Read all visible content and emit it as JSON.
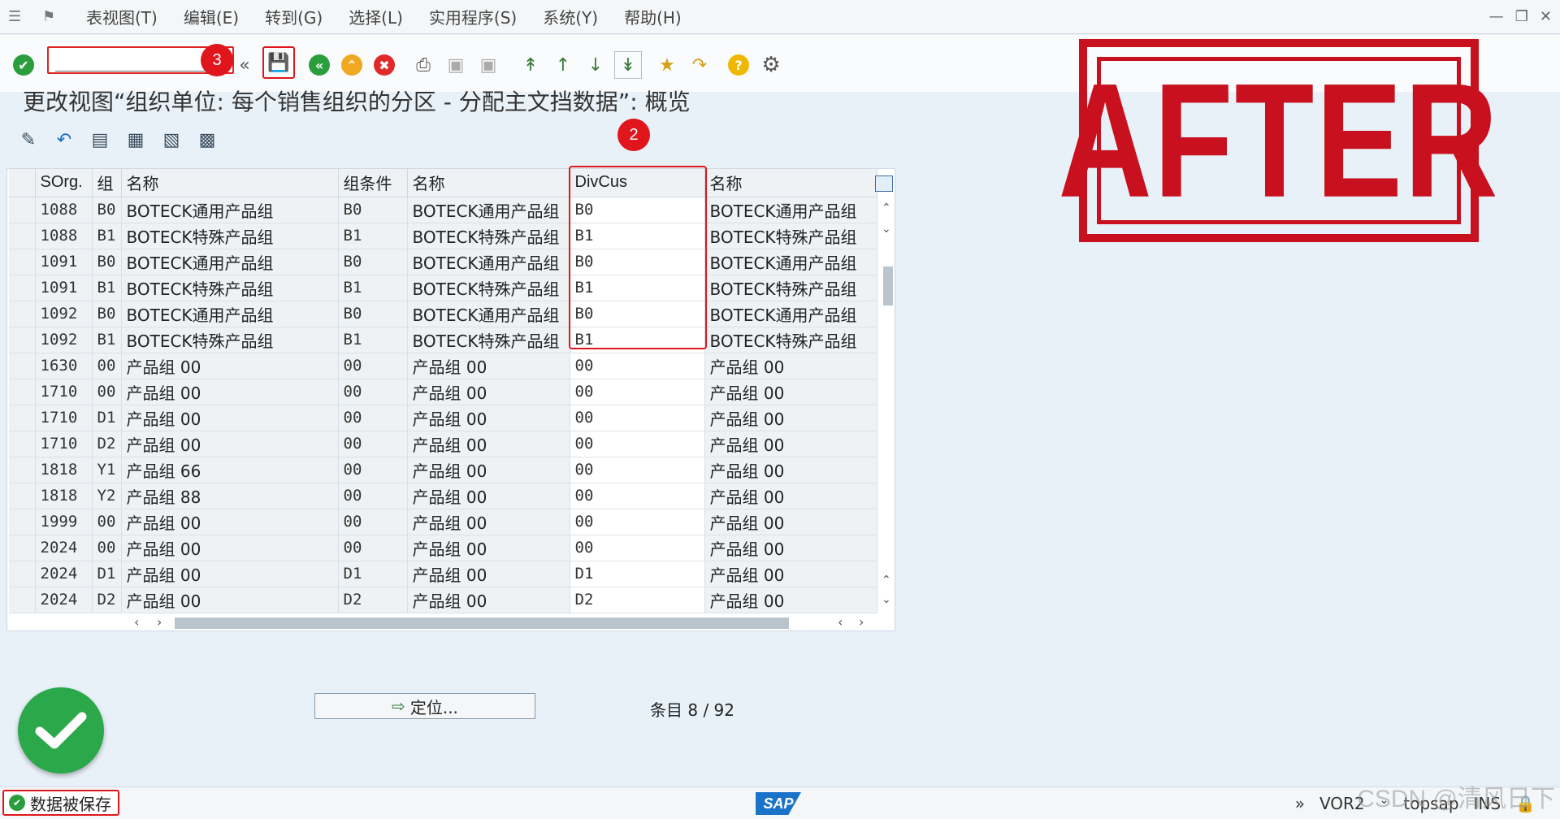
{
  "menubar": {
    "items": [
      "表视图(T)",
      "编辑(E)",
      "转到(G)",
      "选择(L)",
      "实用程序(S)",
      "系统(Y)",
      "帮助(H)"
    ]
  },
  "toolbar": {
    "command_value": "",
    "badge_3": "3",
    "badge_2": "2"
  },
  "title": "更改视图“组织单位: 每个销售组织的分区 - 分配主文挡数据”: 概览",
  "table": {
    "headers": [
      "SOrg.",
      "组",
      "名称",
      "组条件",
      "名称",
      "DivCus",
      "名称"
    ],
    "rows": [
      [
        "1088",
        "B0",
        "BOTECK通用产品组",
        "B0",
        "BOTECK通用产品组",
        "B0",
        "BOTECK通用产品组"
      ],
      [
        "1088",
        "B1",
        "BOTECK特殊产品组",
        "B1",
        "BOTECK特殊产品组",
        "B1",
        "BOTECK特殊产品组"
      ],
      [
        "1091",
        "B0",
        "BOTECK通用产品组",
        "B0",
        "BOTECK通用产品组",
        "B0",
        "BOTECK通用产品组"
      ],
      [
        "1091",
        "B1",
        "BOTECK特殊产品组",
        "B1",
        "BOTECK特殊产品组",
        "B1",
        "BOTECK特殊产品组"
      ],
      [
        "1092",
        "B0",
        "BOTECK通用产品组",
        "B0",
        "BOTECK通用产品组",
        "B0",
        "BOTECK通用产品组"
      ],
      [
        "1092",
        "B1",
        "BOTECK特殊产品组",
        "B1",
        "BOTECK特殊产品组",
        "B1",
        "BOTECK特殊产品组"
      ],
      [
        "1630",
        "00",
        "产品组 00",
        "00",
        "产品组 00",
        "00",
        "产品组 00"
      ],
      [
        "1710",
        "00",
        "产品组 00",
        "00",
        "产品组 00",
        "00",
        "产品组 00"
      ],
      [
        "1710",
        "D1",
        "产品组 00",
        "00",
        "产品组 00",
        "00",
        "产品组 00"
      ],
      [
        "1710",
        "D2",
        "产品组 00",
        "00",
        "产品组 00",
        "00",
        "产品组 00"
      ],
      [
        "1818",
        "Y1",
        "产品组 66",
        "00",
        "产品组 00",
        "00",
        "产品组 00"
      ],
      [
        "1818",
        "Y2",
        "产品组 88",
        "00",
        "产品组 00",
        "00",
        "产品组 00"
      ],
      [
        "1999",
        "00",
        "产品组 00",
        "00",
        "产品组 00",
        "00",
        "产品组 00"
      ],
      [
        "2024",
        "00",
        "产品组 00",
        "00",
        "产品组 00",
        "00",
        "产品组 00"
      ],
      [
        "2024",
        "D1",
        "产品组 00",
        "D1",
        "产品组 00",
        "D1",
        "产品组 00"
      ],
      [
        "2024",
        "D2",
        "产品组 00",
        "D2",
        "产品组 00",
        "D2",
        "产品组 00"
      ]
    ]
  },
  "footer": {
    "position_button": "定位...",
    "entry_info": "条目 8 / 92"
  },
  "stamp": "AFTER",
  "statusbar": {
    "message": "数据被保存",
    "logo": "SAP",
    "transaction": "VOR2",
    "server": "topsap",
    "mode": "INS",
    "watermark": "CSDN @清风日下"
  },
  "colors": {
    "accent_red": "#e0161c",
    "stamp_red": "#c8101e",
    "success_green": "#2aa84a"
  }
}
